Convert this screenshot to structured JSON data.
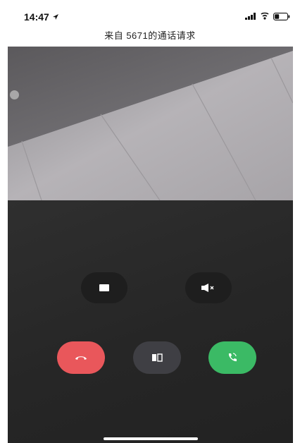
{
  "status_bar": {
    "time": "14:47",
    "icons": [
      "location-arrow-icon",
      "signal-bars-icon",
      "wifi-calling-icon",
      "battery-icon"
    ]
  },
  "call": {
    "title": "来自 5671的通话请求"
  },
  "controls": {
    "video_toggle": "video-toggle-icon",
    "mute": "speaker-mute-icon",
    "decline": "hang-up-icon",
    "switch_camera": "switch-camera-icon",
    "accept": "accept-call-icon"
  },
  "colors": {
    "decline": "#e9575b",
    "accept": "#3bba65",
    "switch": "#3f3f44",
    "screen": "#272727"
  }
}
